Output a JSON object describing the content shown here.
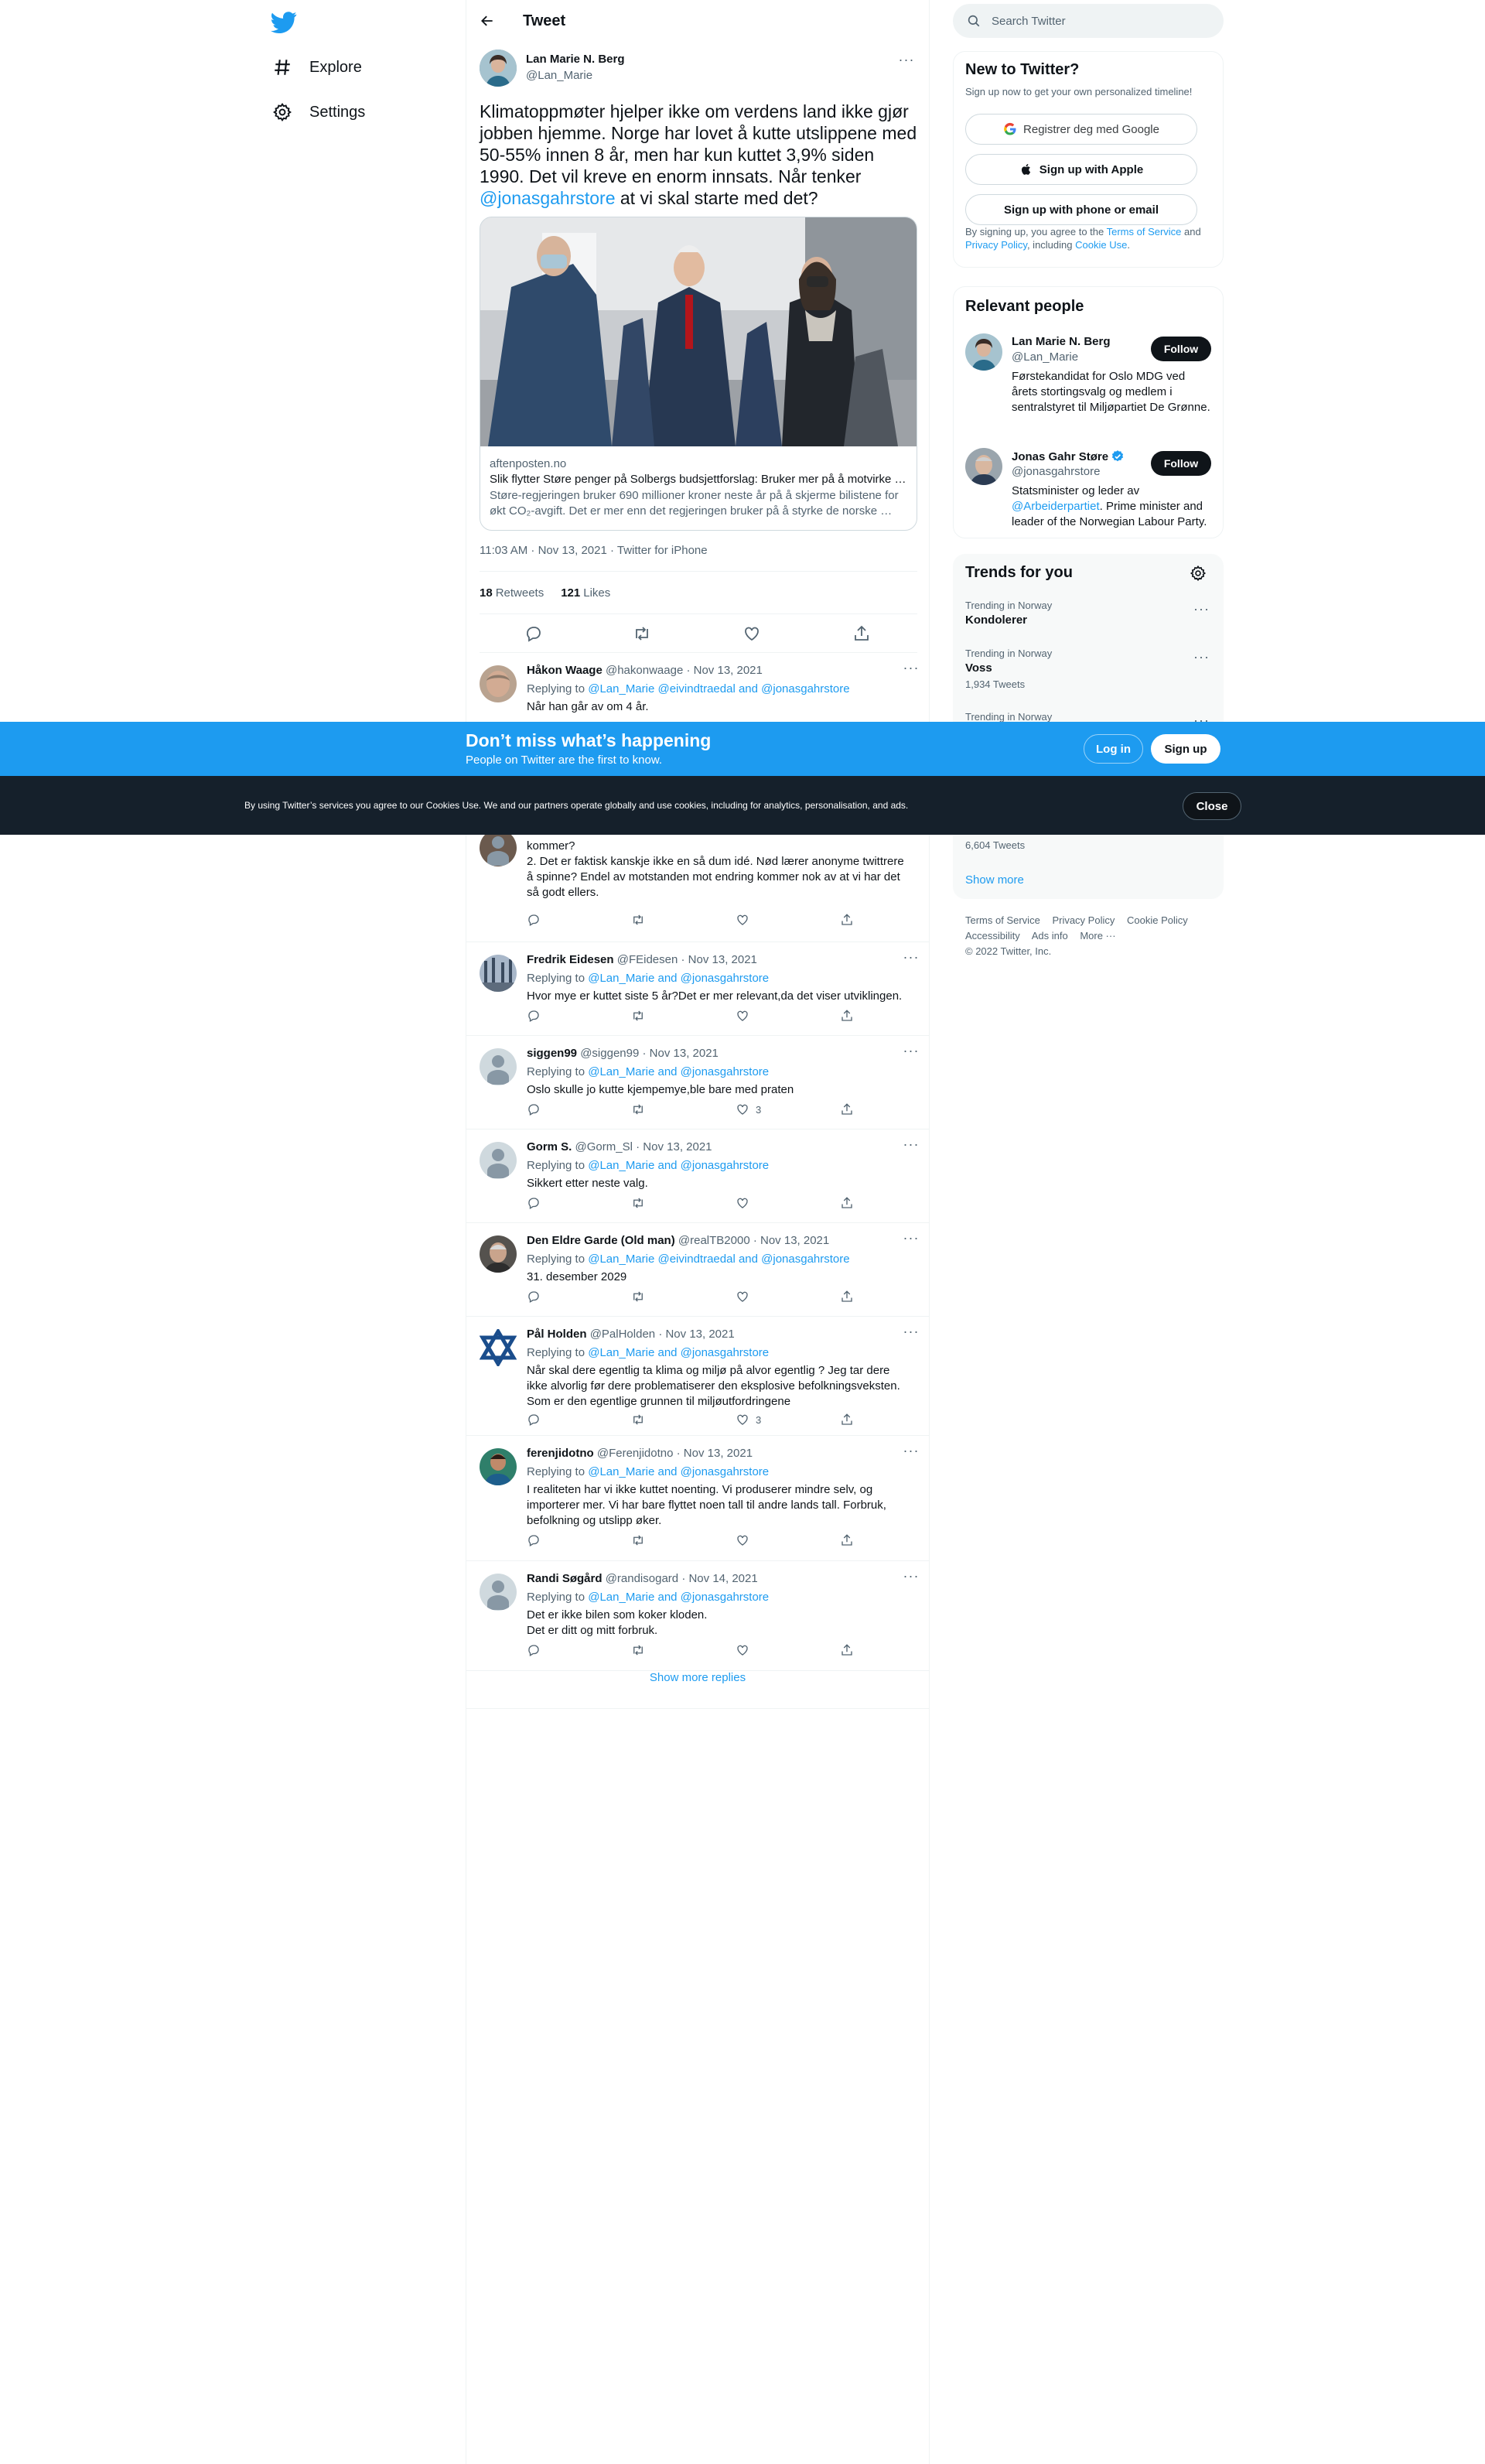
{
  "nav": {
    "items": [
      {
        "label": "Explore",
        "icon": "hashtag-icon"
      },
      {
        "label": "Settings",
        "icon": "gear-icon"
      }
    ]
  },
  "header": {
    "title": "Tweet"
  },
  "main_tweet": {
    "name": "Lan Marie N. Berg",
    "handle": "@Lan_Marie",
    "text_before": "Klimatoppmøter hjelper ikke om verdens land ikke gjør jobben hjemme. Norge har lovet å kutte utslippene med 50-55% innen 8 år, men har kun kuttet 3,9% siden 1990. Det vil kreve en enorm innsats. Når tenker ",
    "mention": "@jonasgahrstore",
    "text_after": " at vi skal starte med det?",
    "card": {
      "domain": "aftenposten.no",
      "title": "Slik flytter Støre penger på Solbergs budsjettforslag: Bruker mer på å motvirke …",
      "desc_line1": "Støre-regjeringen bruker 690 millioner kroner neste år på å skjerme bilistene for",
      "desc_line2": "økt CO₂-avgift. Det er mer enn det regjeringen bruker på å styrke de norske …"
    },
    "meta": "11:03 AM · Nov 13, 2021 · Twitter for iPhone",
    "retweets_count": "18",
    "retweets_label": "Retweets",
    "likes_count": "121",
    "likes_label": "Likes"
  },
  "replies": [
    {
      "name": "Håkon Waage",
      "handle": "@hakonwaage",
      "date": "· Nov 13, 2021",
      "replying_label": "Replying to",
      "replying_to": "@Lan_Marie @eivindtraedal and @jonasgahrstore",
      "text": "Når han går av om 4 år.",
      "likes": ""
    },
    {
      "name": "",
      "handle": "",
      "date": "",
      "replying_label": "",
      "replying_to": "",
      "text": "kommer?\n2. Det er faktisk kanskje ikke en så dum idé. Nød lærer anonyme twittrere å spinne? Endel av motstanden mot endring kommer nok av at vi har det så godt ellers.",
      "likes": ""
    },
    {
      "name": "Fredrik Eidesen",
      "handle": "@FEidesen",
      "date": "· Nov 13, 2021",
      "replying_label": "Replying to",
      "replying_to": "@Lan_Marie and @jonasgahrstore",
      "text": "Hvor mye er kuttet siste 5 år?Det er mer relevant,da det viser utviklingen.",
      "likes": ""
    },
    {
      "name": "siggen99",
      "handle": "@siggen99",
      "date": "· Nov 13, 2021",
      "replying_label": "Replying to",
      "replying_to": "@Lan_Marie and @jonasgahrstore",
      "text": "Oslo skulle jo kutte kjempemye,ble bare med praten",
      "likes": "3"
    },
    {
      "name": "Gorm S.",
      "handle": "@Gorm_Sl",
      "date": "· Nov 13, 2021",
      "replying_label": "Replying to",
      "replying_to": "@Lan_Marie and @jonasgahrstore",
      "text": "Sikkert etter neste valg.",
      "likes": ""
    },
    {
      "name": "Den Eldre Garde (Old man)",
      "handle": "@realTB2000",
      "date": "· Nov 13, 2021",
      "replying_label": "Replying to",
      "replying_to": "@Lan_Marie @eivindtraedal and @jonasgahrstore",
      "text": "31. desember 2029",
      "likes": ""
    },
    {
      "name": "Pål Holden",
      "handle": "@PalHolden",
      "date": "· Nov 13, 2021",
      "replying_label": "Replying to",
      "replying_to": "@Lan_Marie and @jonasgahrstore",
      "text": "Når skal dere egentlig ta klima og miljø på alvor egentlig ? Jeg tar dere ikke alvorlig før dere problematiserer den eksplosive befolkningsveksten. Som er den egentlige grunnen til miljøutfordringene",
      "likes": "3"
    },
    {
      "name": "ferenjidotno",
      "handle": "@Ferenjidotno",
      "date": "· Nov 13, 2021",
      "replying_label": "Replying to",
      "replying_to": "@Lan_Marie and @jonasgahrstore",
      "text": "I realiteten har vi ikke kuttet noenting. Vi produserer mindre selv, og importerer mer. Vi har bare flyttet noen tall til andre lands tall. Forbruk, befolkning og utslipp øker.",
      "likes": ""
    },
    {
      "name": "Randi Søgård",
      "handle": "@randisogard",
      "date": "· Nov 14, 2021",
      "replying_label": "Replying to",
      "replying_to": "@Lan_Marie and @jonasgahrstore",
      "text": "Det er ikke bilen som koker kloden.\nDet er ditt og mitt forbruk.",
      "likes": ""
    }
  ],
  "show_more": "Show more replies",
  "search": {
    "placeholder": "Search Twitter"
  },
  "signup": {
    "title": "New to Twitter?",
    "subtitle": "Sign up now to get your own personalized timeline!",
    "google_label": "Registrer deg med Google",
    "apple_label": "Sign up with Apple",
    "phone_label": "Sign up with phone or email",
    "legal_1": "By signing up, you agree to the ",
    "terms": "Terms of Service",
    "legal_and": " and ",
    "privacy": "Privacy Policy",
    "legal_2": ", including ",
    "cookie_use": "Cookie Use",
    "legal_end": "."
  },
  "relevant": {
    "title": "Relevant people",
    "follow_label": "Follow",
    "people": [
      {
        "name": "Lan Marie N. Berg",
        "handle": "@Lan_Marie",
        "bio": "Førstekandidat for Oslo MDG ved årets stortingsvalg og medlem i sentralstyret til Miljøpartiet De Grønne.",
        "verified": false
      },
      {
        "name": "Jonas Gahr Støre",
        "handle": "@jonasgahrstore",
        "bio_1": "Statsminister og leder av ",
        "bio_link": "@Arbeiderpartiet",
        "bio_2": ". Prime minister and leader of the Norwegian Labour Party.",
        "verified": true
      }
    ]
  },
  "trends": {
    "title": "Trends for you",
    "items": [
      {
        "context": "Trending in Norway",
        "name": "Kondolerer",
        "count": ""
      },
      {
        "context": "Trending in Norway",
        "name": "Voss",
        "count": "1,934 Tweets"
      },
      {
        "context": "Trending in Norway",
        "name": "",
        "count": ""
      }
    ],
    "last_count": "6,604 Tweets",
    "show_more": "Show more"
  },
  "footer": {
    "links": [
      "Terms of Service",
      "Privacy Policy",
      "Cookie Policy",
      "Accessibility",
      "Ads info",
      "More ···"
    ],
    "copyright": "© 2022 Twitter, Inc."
  },
  "banner": {
    "title": "Don’t miss what’s happening",
    "subtitle": "People on Twitter are the first to know.",
    "login_label": "Log in",
    "signup_label": "Sign up"
  },
  "cookie": {
    "text": "By using Twitter’s services you agree to our Cookies Use. We and our partners operate globally and use cookies, including for analytics, personalisation, and ads.",
    "close_label": "Close"
  },
  "colors": {
    "accent": "#1d9bf0",
    "text": "#0f1419",
    "muted": "#536471",
    "cookie_bg": "#15202b"
  }
}
